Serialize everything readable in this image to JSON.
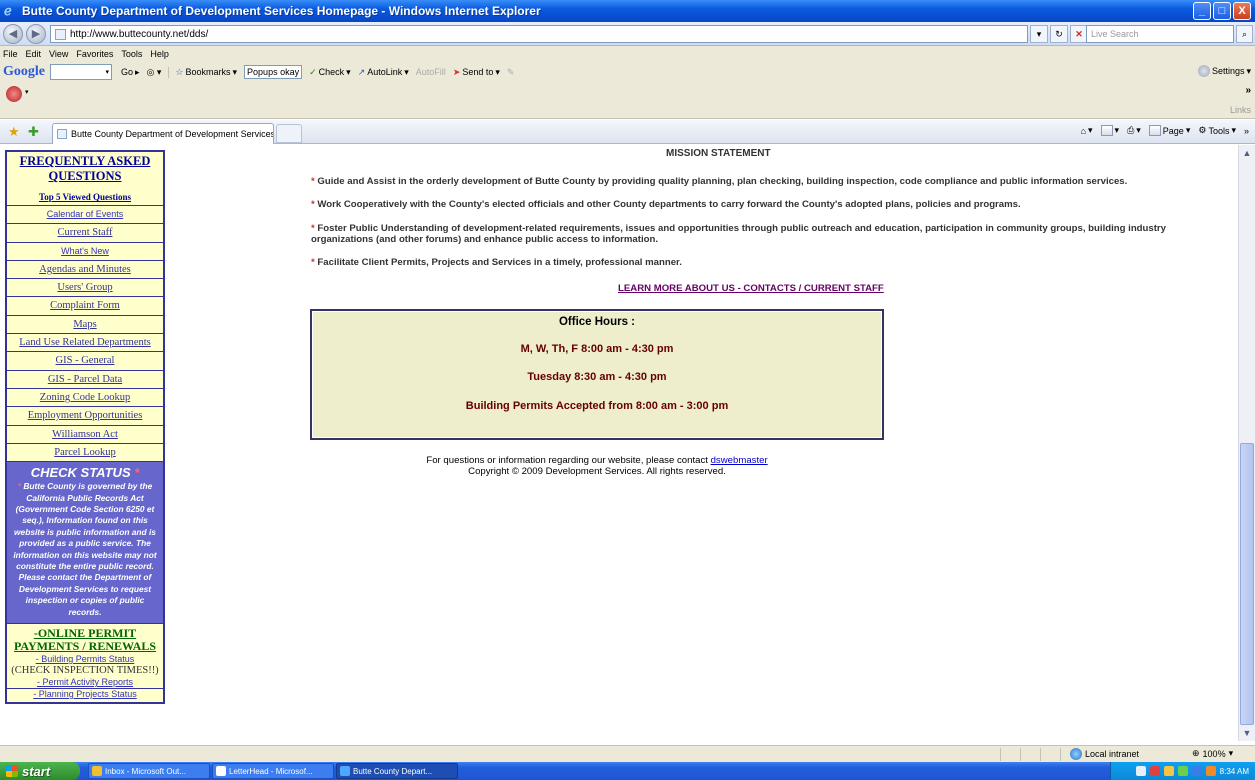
{
  "window": {
    "title": "Butte County Department of Development Services Homepage - Windows Internet Explorer",
    "controls": [
      "_",
      "□",
      "X"
    ]
  },
  "address_bar": {
    "url": "http://www.buttecounty.net/dds/",
    "search_placeholder": "Live Search"
  },
  "menu": [
    "File",
    "Edit",
    "View",
    "Favorites",
    "Tools",
    "Help"
  ],
  "google_toolbar": {
    "logo": "Google",
    "go_label": "Go",
    "bookmarks_label": "Bookmarks",
    "popups_label": "Popups okay",
    "check_label": "Check",
    "autolink_label": "AutoLink",
    "autofill_label": "AutoFill",
    "sendto_label": "Send to",
    "settings_label": "Settings",
    "links_label": "Links"
  },
  "tabs": {
    "active_title": "Butte County Department of Development Services H..."
  },
  "command_bar": {
    "page_label": "Page",
    "tools_label": "Tools"
  },
  "sidebar": {
    "faq_title": "FREQUENTLY ASKED QUESTIONS",
    "top5_label": "Top 5 Viewed Questions",
    "links": [
      {
        "label": "Calendar of Events",
        "style": "small"
      },
      {
        "label": "Current Staff",
        "style": "serif"
      },
      {
        "label": "What's New",
        "style": "small"
      },
      {
        "label": "Agendas and Minutes",
        "style": "serif"
      },
      {
        "label": "Users' Group",
        "style": "serif"
      },
      {
        "label": "Complaint Form",
        "style": "serif"
      },
      {
        "label": "Maps",
        "style": "serif"
      },
      {
        "label": "Land Use Related Departments",
        "style": "serif"
      },
      {
        "label": "GIS - General",
        "style": "serif"
      },
      {
        "label": "GIS - Parcel Data",
        "style": "serif"
      },
      {
        "label": "Zoning Code Lookup",
        "style": "serif"
      },
      {
        "label": "Employment Opportunities",
        "style": "serif"
      },
      {
        "label": "Williamson Act",
        "style": "serif"
      },
      {
        "label": "Parcel Lookup",
        "style": "serif"
      }
    ],
    "check_status": {
      "title": "CHECK STATUS",
      "star": "*",
      "body": "Butte County is governed by the California Public Records Act (Government Code Section 6250 et seq.), Information found on this website is public information and is provided as a public service.  The information on this website may not constitute the entire public record.  Please contact the Department of Development Services to request inspection or copies of public records."
    },
    "online": {
      "title": "-ONLINE PERMIT PAYMENTS / RENEWALS",
      "building_status": "- Building Permits Status",
      "inspection_note": "(CHECK INSPECTION TIMES!!)",
      "activity_reports": "- Permit Activity Reports",
      "planning_status": "- Planning Projects Status"
    }
  },
  "main": {
    "mission_title": "MISSION STATEMENT",
    "mission_items": [
      "Guide and Assist in the orderly development of Butte County by providing quality planning, plan checking, building inspection, code compliance and public information services.",
      "Work Cooperatively with the County's elected officials and other County departments to carry forward the County's adopted plans, policies and programs.",
      "Foster Public Understanding of development-related requirements, issues and opportunities through public outreach and education, participation in community groups, building industry organizations (and other forums) and enhance public access to information.",
      "Facilitate Client Permits, Projects and Services in a timely, professional manner."
    ],
    "learn_more": "LEARN MORE ABOUT US - CONTACTS / CURRENT STAFF",
    "office_hours": {
      "title": "Office Hours :",
      "lines": [
        "M, W, Th, F 8:00 am - 4:30 pm",
        "Tuesday 8:30 am - 4:30 pm",
        "Building Permits Accepted from 8:00 am - 3:00 pm"
      ]
    },
    "footer_contact": "For questions or information regarding our website, please contact",
    "footer_link": "dswebmaster",
    "copyright": "Copyright © 2009 Development Services. All rights reserved."
  },
  "status_bar": {
    "zone": "Local intranet",
    "zoom": "100%"
  },
  "taskbar": {
    "start": "start",
    "tasks": [
      {
        "label": "Inbox - Microsoft Out...",
        "color": "#f0c030",
        "active": false
      },
      {
        "label": "LetterHead - Microsof...",
        "color": "#ffffff",
        "active": false
      },
      {
        "label": "Butte County Depart...",
        "color": "#4fa8ff",
        "active": true
      }
    ],
    "clock": "8:34 AM"
  }
}
